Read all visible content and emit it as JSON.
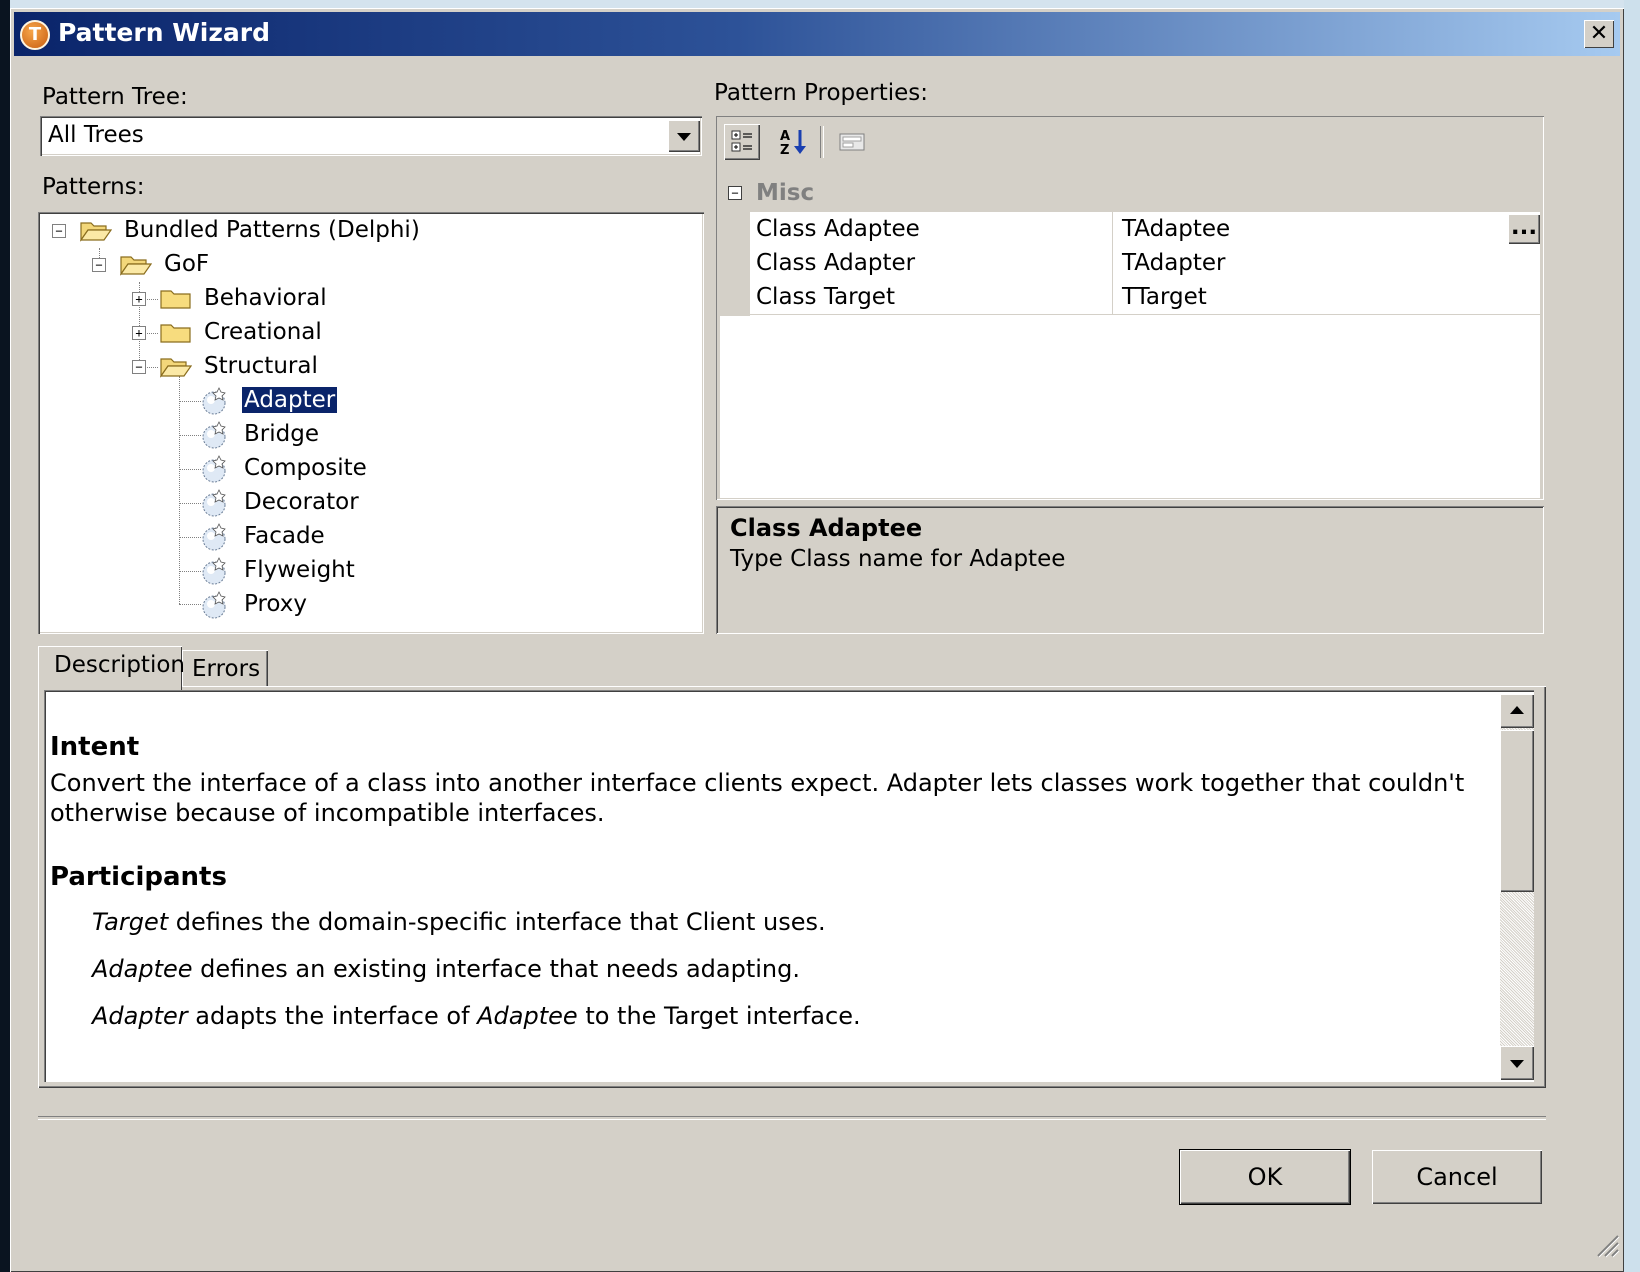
{
  "window": {
    "title": "Pattern Wizard",
    "app_icon_letter": "T",
    "close_glyph": "✕"
  },
  "left": {
    "pattern_tree_label": "Pattern Tree:",
    "pattern_tree_value": "All Trees",
    "patterns_label": "Patterns:"
  },
  "tree": {
    "root": {
      "label": "Bundled Patterns (Delphi)",
      "expanded": true
    },
    "gof": {
      "label": "GoF",
      "expanded": true
    },
    "behavioral": {
      "label": "Behavioral",
      "expanded": false
    },
    "creational": {
      "label": "Creational",
      "expanded": false
    },
    "structural": {
      "label": "Structural",
      "expanded": true
    },
    "items": [
      "Adapter",
      "Bridge",
      "Composite",
      "Decorator",
      "Facade",
      "Flyweight",
      "Proxy"
    ],
    "selected": "Adapter"
  },
  "properties": {
    "label": "Pattern Properties:",
    "category": "Misc",
    "rows": [
      {
        "name": "Class Adaptee",
        "value": "TAdaptee"
      },
      {
        "name": "Class Adapter",
        "value": "TAdapter"
      },
      {
        "name": "Class Target",
        "value": "TTarget"
      }
    ],
    "ellipsis": "...",
    "help_title": "Class Adaptee",
    "help_text": "Type Class name for Adaptee"
  },
  "tabs": {
    "description": "Description",
    "errors": "Errors",
    "active": "Description"
  },
  "description": {
    "intent_heading": "Intent",
    "intent_line1": "Convert the interface of a class into another interface clients expect. Adapter lets classes work together that couldn't",
    "intent_line2": "otherwise because of incompatible interfaces.",
    "participants_heading": "Participants",
    "p1_term": "Target",
    "p1_text": " defines the domain-specific interface that Client uses.",
    "p2_term": "Adaptee",
    "p2_text": " defines an existing interface that needs adapting.",
    "p3_term": "Adapter",
    "p3_text_a": " adapts the interface of ",
    "p3_term2": "Adaptee",
    "p3_text_b": " to the Target interface."
  },
  "buttons": {
    "ok": "OK",
    "cancel": "Cancel"
  },
  "colors": {
    "title_start": "#0a246a",
    "title_end": "#a6caf0",
    "dialog_face": "#d4d0c8",
    "selection": "#0a246a"
  }
}
